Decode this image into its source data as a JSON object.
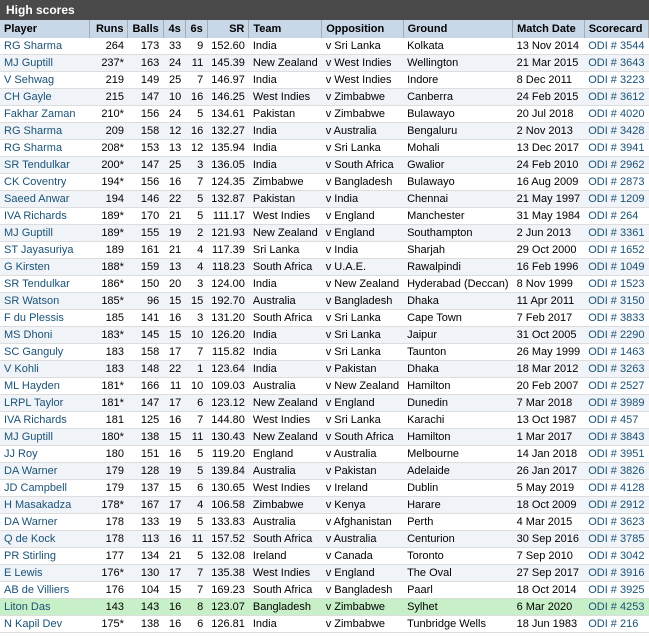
{
  "title": "High scores",
  "headers": [
    "Player",
    "Runs",
    "Balls",
    "4s",
    "6s",
    "SR",
    "Team",
    "Opposition",
    "Ground",
    "Match Date",
    "Scorecard"
  ],
  "rows": [
    [
      "RG Sharma",
      "264",
      "173",
      "33",
      "9",
      "152.60",
      "India",
      "v Sri Lanka",
      "Kolkata",
      "13 Nov 2014",
      "ODI # 3544"
    ],
    [
      "MJ Guptill",
      "237*",
      "163",
      "24",
      "11",
      "145.39",
      "New Zealand",
      "v West Indies",
      "Wellington",
      "21 Mar 2015",
      "ODI # 3643"
    ],
    [
      "V Sehwag",
      "219",
      "149",
      "25",
      "7",
      "146.97",
      "India",
      "v West Indies",
      "Indore",
      "8 Dec 2011",
      "ODI # 3223"
    ],
    [
      "CH Gayle",
      "215",
      "147",
      "10",
      "16",
      "146.25",
      "West Indies",
      "v Zimbabwe",
      "Canberra",
      "24 Feb 2015",
      "ODI # 3612"
    ],
    [
      "Fakhar Zaman",
      "210*",
      "156",
      "24",
      "5",
      "134.61",
      "Pakistan",
      "v Zimbabwe",
      "Bulawayo",
      "20 Jul 2018",
      "ODI # 4020"
    ],
    [
      "RG Sharma",
      "209",
      "158",
      "12",
      "16",
      "132.27",
      "India",
      "v Australia",
      "Bengaluru",
      "2 Nov 2013",
      "ODI # 3428"
    ],
    [
      "RG Sharma",
      "208*",
      "153",
      "13",
      "12",
      "135.94",
      "India",
      "v Sri Lanka",
      "Mohali",
      "13 Dec 2017",
      "ODI # 3941"
    ],
    [
      "SR Tendulkar",
      "200*",
      "147",
      "25",
      "3",
      "136.05",
      "India",
      "v South Africa",
      "Gwalior",
      "24 Feb 2010",
      "ODI # 2962"
    ],
    [
      "CK Coventry",
      "194*",
      "156",
      "16",
      "7",
      "124.35",
      "Zimbabwe",
      "v Bangladesh",
      "Bulawayo",
      "16 Aug 2009",
      "ODI # 2873"
    ],
    [
      "Saeed Anwar",
      "194",
      "146",
      "22",
      "5",
      "132.87",
      "Pakistan",
      "v India",
      "Chennai",
      "21 May 1997",
      "ODI # 1209"
    ],
    [
      "IVA Richards",
      "189*",
      "170",
      "21",
      "5",
      "111.17",
      "West Indies",
      "v England",
      "Manchester",
      "31 May 1984",
      "ODI # 264"
    ],
    [
      "MJ Guptill",
      "189*",
      "155",
      "19",
      "2",
      "121.93",
      "New Zealand",
      "v England",
      "Southampton",
      "2 Jun 2013",
      "ODI # 3361"
    ],
    [
      "ST Jayasuriya",
      "189",
      "161",
      "21",
      "4",
      "117.39",
      "Sri Lanka",
      "v India",
      "Sharjah",
      "29 Oct 2000",
      "ODI # 1652"
    ],
    [
      "G Kirsten",
      "188*",
      "159",
      "13",
      "4",
      "118.23",
      "South Africa",
      "v U.A.E.",
      "Rawalpindi",
      "16 Feb 1996",
      "ODI # 1049"
    ],
    [
      "SR Tendulkar",
      "186*",
      "150",
      "20",
      "3",
      "124.00",
      "India",
      "v New Zealand",
      "Hyderabad (Deccan)",
      "8 Nov 1999",
      "ODI # 1523"
    ],
    [
      "SR Watson",
      "185*",
      "96",
      "15",
      "15",
      "192.70",
      "Australia",
      "v Bangladesh",
      "Dhaka",
      "11 Apr 2011",
      "ODI # 3150"
    ],
    [
      "F du Plessis",
      "185",
      "141",
      "16",
      "3",
      "131.20",
      "South Africa",
      "v Sri Lanka",
      "Cape Town",
      "7 Feb 2017",
      "ODI # 3833"
    ],
    [
      "MS Dhoni",
      "183*",
      "145",
      "15",
      "10",
      "126.20",
      "India",
      "v Sri Lanka",
      "Jaipur",
      "31 Oct 2005",
      "ODI # 2290"
    ],
    [
      "SC Ganguly",
      "183",
      "158",
      "17",
      "7",
      "115.82",
      "India",
      "v Sri Lanka",
      "Taunton",
      "26 May 1999",
      "ODI # 1463"
    ],
    [
      "V Kohli",
      "183",
      "148",
      "22",
      "1",
      "123.64",
      "India",
      "v Pakistan",
      "Dhaka",
      "18 Mar 2012",
      "ODI # 3263"
    ],
    [
      "ML Hayden",
      "181*",
      "166",
      "11",
      "10",
      "109.03",
      "Australia",
      "v New Zealand",
      "Hamilton",
      "20 Feb 2007",
      "ODI # 2527"
    ],
    [
      "LRPL Taylor",
      "181*",
      "147",
      "17",
      "6",
      "123.12",
      "New Zealand",
      "v England",
      "Dunedin",
      "7 Mar 2018",
      "ODI # 3989"
    ],
    [
      "IVA Richards",
      "181",
      "125",
      "16",
      "7",
      "144.80",
      "West Indies",
      "v Sri Lanka",
      "Karachi",
      "13 Oct 1987",
      "ODI # 457"
    ],
    [
      "MJ Guptill",
      "180*",
      "138",
      "15",
      "11",
      "130.43",
      "New Zealand",
      "v South Africa",
      "Hamilton",
      "1 Mar 2017",
      "ODI # 3843"
    ],
    [
      "JJ Roy",
      "180",
      "151",
      "16",
      "5",
      "119.20",
      "England",
      "v Australia",
      "Melbourne",
      "14 Jan 2018",
      "ODI # 3951"
    ],
    [
      "DA Warner",
      "179",
      "128",
      "19",
      "5",
      "139.84",
      "Australia",
      "v Pakistan",
      "Adelaide",
      "26 Jan 2017",
      "ODI # 3826"
    ],
    [
      "JD Campbell",
      "179",
      "137",
      "15",
      "6",
      "130.65",
      "West Indies",
      "v Ireland",
      "Dublin",
      "5 May 2019",
      "ODI # 4128"
    ],
    [
      "H Masakadza",
      "178*",
      "167",
      "17",
      "4",
      "106.58",
      "Zimbabwe",
      "v Kenya",
      "Harare",
      "18 Oct 2009",
      "ODI # 2912"
    ],
    [
      "DA Warner",
      "178",
      "133",
      "19",
      "5",
      "133.83",
      "Australia",
      "v Afghanistan",
      "Perth",
      "4 Mar 2015",
      "ODI # 3623"
    ],
    [
      "Q de Kock",
      "178",
      "113",
      "16",
      "11",
      "157.52",
      "South Africa",
      "v Australia",
      "Centurion",
      "30 Sep 2016",
      "ODI # 3785"
    ],
    [
      "PR Stirling",
      "177",
      "134",
      "21",
      "5",
      "132.08",
      "Ireland",
      "v Canada",
      "Toronto",
      "7 Sep 2010",
      "ODI # 3042"
    ],
    [
      "E Lewis",
      "176*",
      "130",
      "17",
      "7",
      "135.38",
      "West Indies",
      "v England",
      "The Oval",
      "27 Sep 2017",
      "ODI # 3916"
    ],
    [
      "AB de Villiers",
      "176",
      "104",
      "15",
      "7",
      "169.23",
      "South Africa",
      "v Bangladesh",
      "Paarl",
      "18 Oct 2014",
      "ODI # 3925"
    ],
    [
      "Liton Das",
      "143",
      "143",
      "16",
      "8",
      "123.07",
      "Bangladesh",
      "v Zimbabwe",
      "Sylhet",
      "6 Mar 2020",
      "ODI # 4253"
    ],
    [
      "N Kapil Dev",
      "175*",
      "138",
      "16",
      "6",
      "126.81",
      "India",
      "v Zimbabwe",
      "Tunbridge Wells",
      "18 Jun 1983",
      "ODI # 216"
    ]
  ],
  "highlighted_row": 33
}
